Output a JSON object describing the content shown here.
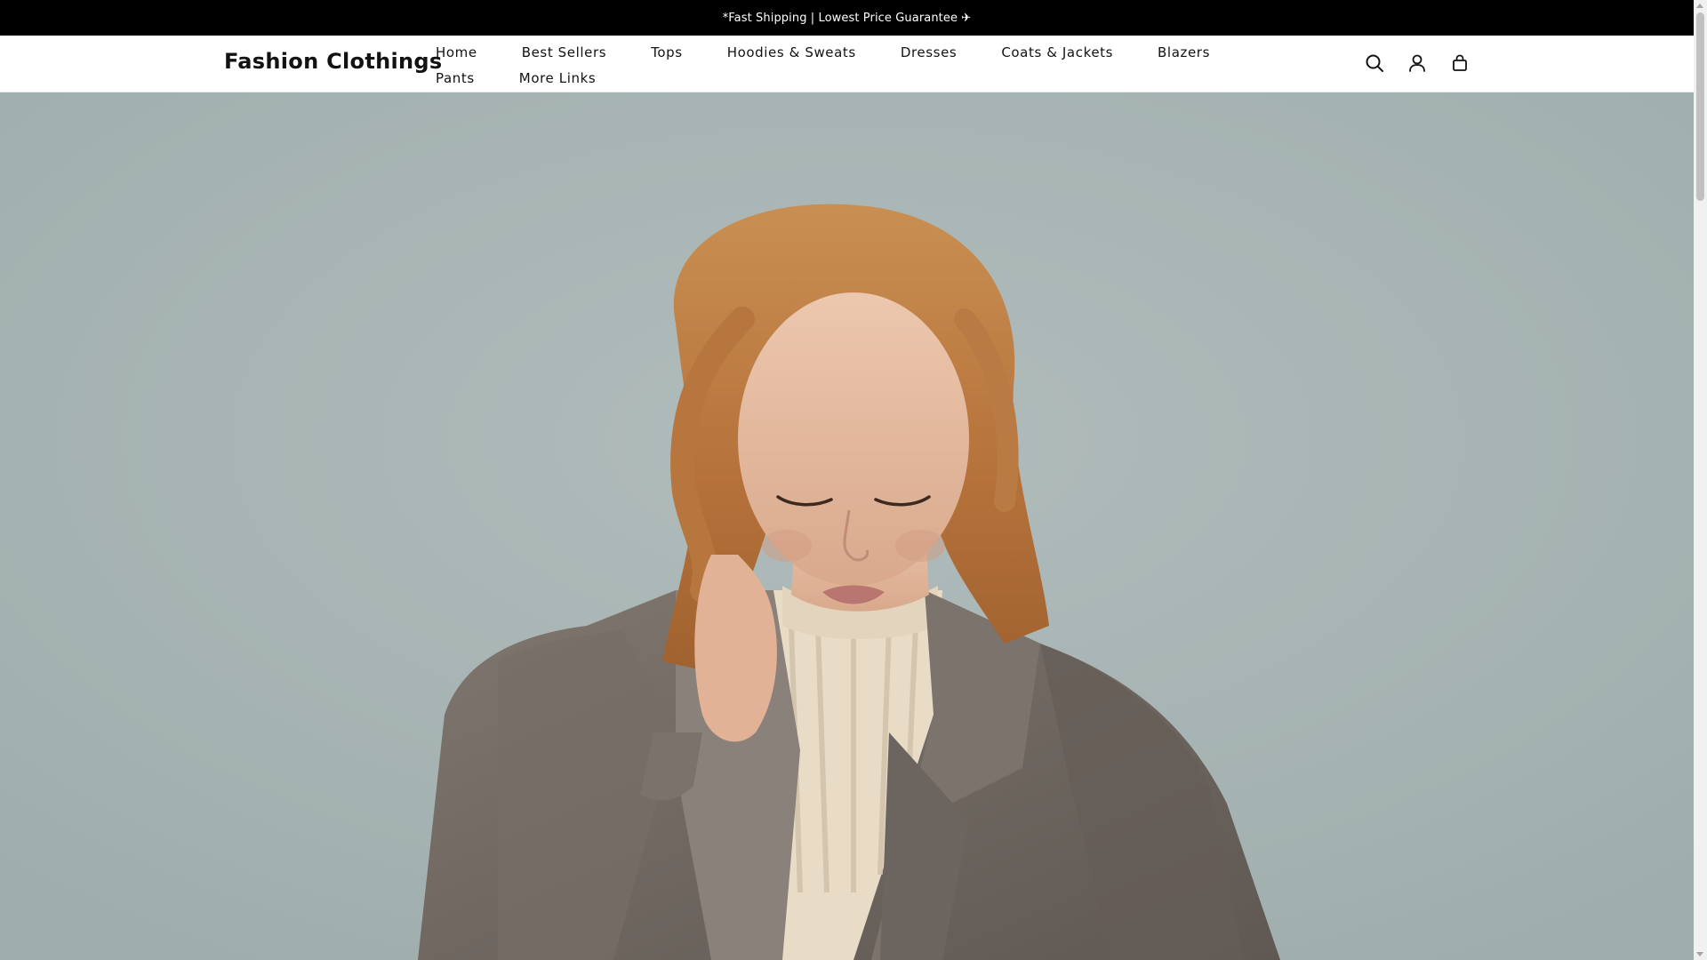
{
  "announcement": {
    "text": "*Fast Shipping | Lowest Price Guarantee ✈"
  },
  "header": {
    "logo": "Fashion Clothings",
    "nav": [
      {
        "label": "Home"
      },
      {
        "label": "Best Sellers"
      },
      {
        "label": "Tops"
      },
      {
        "label": "Hoodies & Sweats"
      },
      {
        "label": "Dresses"
      },
      {
        "label": "Coats & Jackets"
      },
      {
        "label": "Blazers"
      },
      {
        "label": "Pants"
      },
      {
        "label": "More Links"
      }
    ],
    "icons": [
      "search-icon",
      "account-icon",
      "cart-icon"
    ]
  },
  "hero": {
    "image": "woman-in-grey-wool-coat-and-cream-cable-knit-sweater",
    "background_color": "#a7b3b2"
  },
  "colors": {
    "announcement_bg": "#000000",
    "text": "#121212"
  }
}
